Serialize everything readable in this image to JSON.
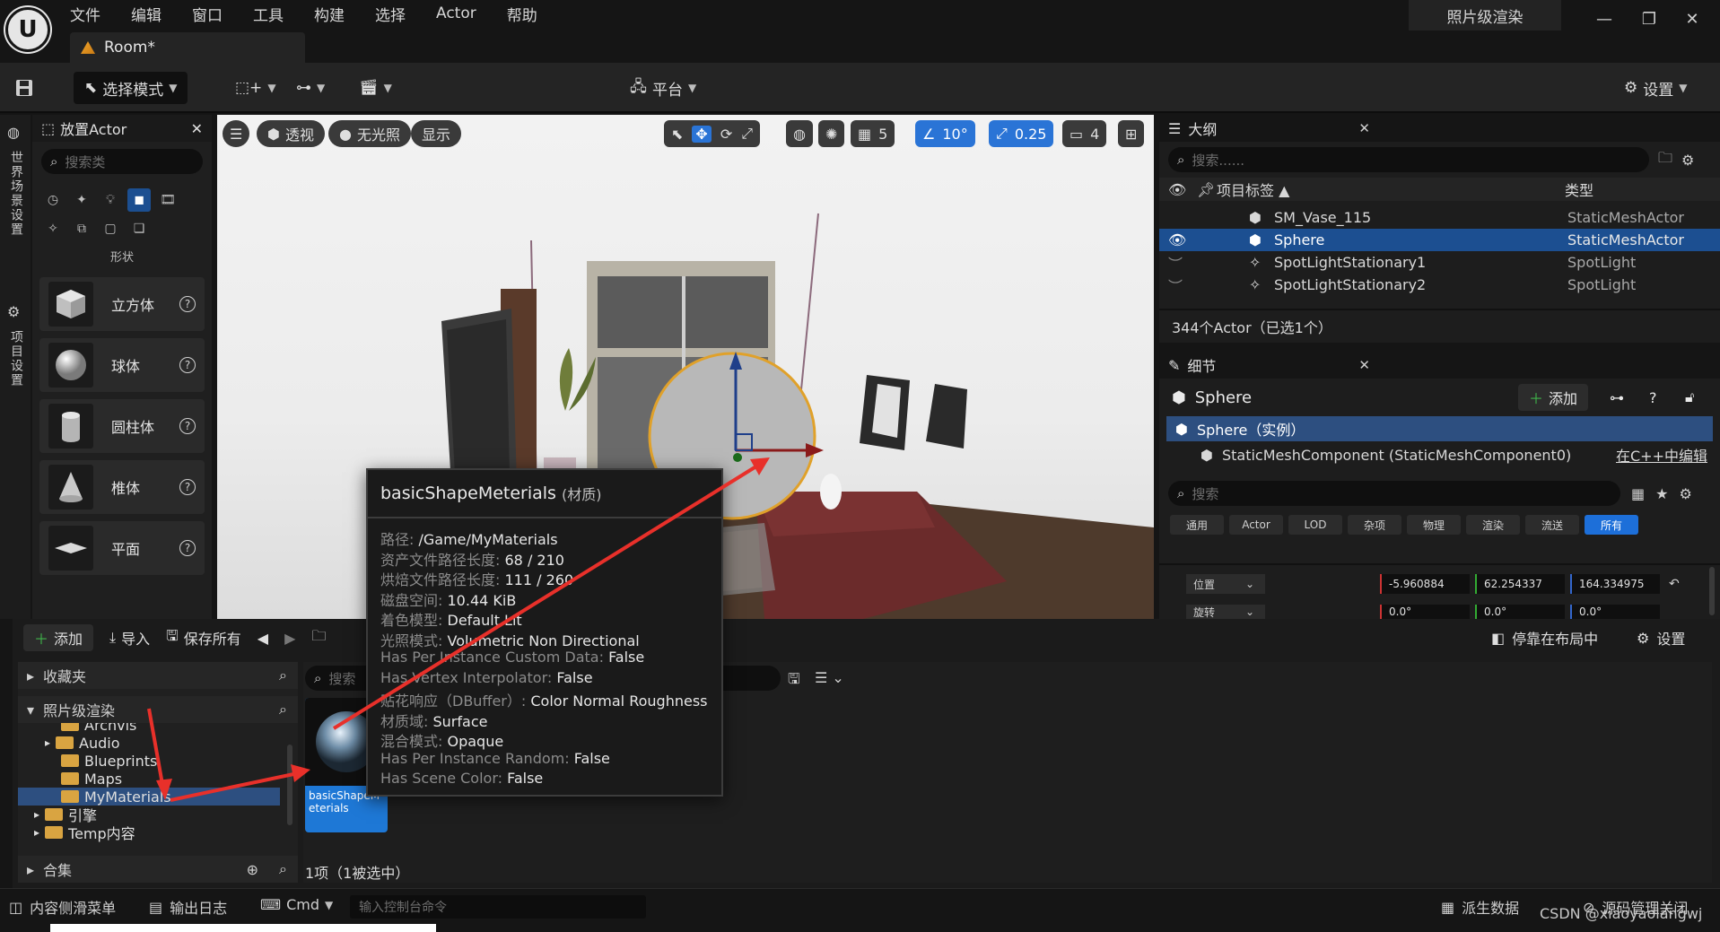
{
  "menu": {
    "items": [
      "文件",
      "编辑",
      "窗口",
      "工具",
      "构建",
      "选择",
      "Actor",
      "帮助"
    ],
    "project_name": "照片级渲染",
    "document_tab": "Room*"
  },
  "toolbar": {
    "select_mode": "选择模式",
    "platform": "平台",
    "settings": "设置"
  },
  "left_strip": {
    "world_settings": "世界场景设置",
    "project_settings": "项目设置"
  },
  "place_actor": {
    "title": "放置Actor",
    "search_placeholder": "搜索类",
    "category_label": "形状",
    "shapes": [
      {
        "label": "立方体",
        "icon": "cube-icon"
      },
      {
        "label": "球体",
        "icon": "sphere-icon"
      },
      {
        "label": "圆柱体",
        "icon": "cylinder-icon"
      },
      {
        "label": "椎体",
        "icon": "cone-icon"
      },
      {
        "label": "平面",
        "icon": "plane-icon"
      }
    ]
  },
  "viewport": {
    "perspective": "透视",
    "lit": "无光照",
    "show": "显示",
    "grid_value": "5",
    "angle_value": "10°",
    "scale_value": "0.25",
    "camera_speed": "4"
  },
  "outline": {
    "title": "大纲",
    "search_placeholder": "搜索......",
    "col_label": "项目标签 ▲",
    "col_type": "类型",
    "rows": [
      {
        "name": "SM_Vase_115",
        "type": "StaticMeshActor",
        "selected": false
      },
      {
        "name": "Sphere",
        "type": "StaticMeshActor",
        "selected": true
      },
      {
        "name": "SpotLightStationary1",
        "type": "SpotLight",
        "selected": false
      },
      {
        "name": "SpotLightStationary2",
        "type": "SpotLight",
        "selected": false
      }
    ],
    "summary": "344个Actor（已选1个）"
  },
  "details": {
    "title": "细节",
    "actor_name": "Sphere",
    "add_label": "添加",
    "instance_label": "Sphere（实例）",
    "component_label": "StaticMeshComponent (StaticMeshComponent0)",
    "edit_cpp": "在C++中编辑",
    "search_placeholder": "搜索",
    "filters": [
      "通用",
      "Actor",
      "LOD",
      "杂项",
      "物理",
      "渲染",
      "流送",
      "所有"
    ],
    "location_label": "位置",
    "location": [
      "-5.960884",
      "62.254337",
      "164.334975"
    ],
    "rotation_label": "旋转",
    "rotation": [
      "0.0°",
      "0.0°",
      "0.0°"
    ]
  },
  "content_browser": {
    "add": "添加",
    "import": "导入",
    "save_all": "保存所有",
    "dock": "停靠在布局中",
    "settings": "设置",
    "favorites": "收藏夹",
    "root": "照片级渲染",
    "folders": [
      "Archvis",
      "Audio",
      "Blueprints",
      "Maps",
      "MyMaterials"
    ],
    "engine": "引擎",
    "temp": "Temp内容",
    "collections": "合集",
    "search_placeholder": "搜索",
    "asset_name": "basicShapeMeterials",
    "item_count": "1项（1被选中）"
  },
  "tooltip": {
    "title": "basicShapeMeterials",
    "title_suffix": "(材质)",
    "lines": [
      {
        "key": "路径:",
        "val": "/Game/MyMaterials"
      },
      {
        "key": "资产文件路径长度:",
        "val": "68 / 210"
      },
      {
        "key": "烘焙文件路径长度:",
        "val": "111 / 260"
      },
      {
        "key": "磁盘空间:",
        "val": "10.44 KiB"
      },
      {
        "key": "着色模型:",
        "val": "Default Lit"
      },
      {
        "key": "光照模式:",
        "val": "Volumetric Non Directional"
      },
      {
        "key": "Has Per Instance Custom Data:",
        "val": "False"
      },
      {
        "key": "Has Vertex Interpolator:",
        "val": "False"
      },
      {
        "key": "贴花响应（DBuffer）:",
        "val": "Color Normal Roughness"
      },
      {
        "key": "材质域:",
        "val": "Surface"
      },
      {
        "key": "混合模式:",
        "val": "Opaque"
      },
      {
        "key": "Has Per Instance Random:",
        "val": "False"
      },
      {
        "key": "Has Scene Color:",
        "val": "False"
      }
    ]
  },
  "statusbar": {
    "content_drawer": "内容侧滑菜单",
    "output_log": "输出日志",
    "cmd": "Cmd",
    "console_placeholder": "输入控制台命令",
    "derived_data": "派生数据",
    "source_control": "源码管理关闭",
    "watermark": "CSDN @xiaoyaolangwj"
  },
  "colors": {
    "selection_blue": "#1c4f91",
    "accent_blue": "#1d6fd9",
    "play_green": "#3fb54a",
    "folder_yellow": "#d9a441",
    "annotation_red": "#e8302a"
  }
}
